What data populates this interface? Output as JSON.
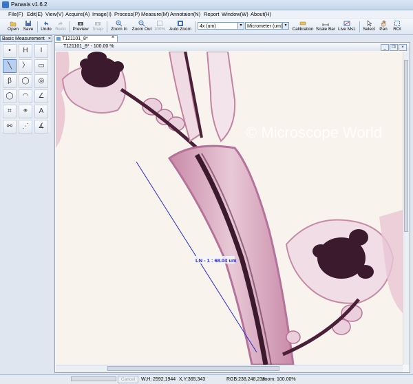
{
  "app": {
    "title": "Panasis v1.6.2"
  },
  "menu": [
    "File(F)",
    "Edit(E)",
    "View(V)",
    "Acquire(A)",
    "Image(I)",
    "Process(P)",
    "Measure(M)",
    "Annotaion(N)",
    "Report",
    "Window(W)",
    "About(H)"
  ],
  "toolbar": {
    "open": "Open",
    "save": "Save",
    "undo": "Undo",
    "redo": "Redo",
    "preview": "Preview",
    "snap": "Snap",
    "zoom_in": "Zoom In",
    "zoom_out": "Zoom Out",
    "zoom_100": "100%",
    "auto_zoom": "Auto Zoom",
    "objective_value": "4x (um)",
    "unit_value": "Micrometer (um)",
    "calibration": "Calibration",
    "scale_bar": "Scale Bar",
    "live_mst": "Live Mst.",
    "select": "Select",
    "pan": "Pan",
    "roi": "ROI"
  },
  "panel": {
    "title": "Basic Measurement",
    "close": "×"
  },
  "tools": [
    "•",
    "H",
    "I",
    "╲",
    "〉",
    "▭",
    "β",
    "◯",
    "◎",
    "◯",
    "◠",
    "∠",
    "⌗",
    "⚭",
    "A",
    "⚯",
    "⋰",
    "∡"
  ],
  "document": {
    "tab_label": "T121101_8*",
    "tab_close": "×",
    "window_title": "T121101_8* - 100.00 %",
    "watermark": "© Microscope World",
    "measurement_label": "LN - 1 : 68.04 um"
  },
  "status": {
    "cancel": "Cancel",
    "wh": "W,H: 2592,1944",
    "xy": "X,Y:365,343",
    "rgb": "RGB:238,248,238",
    "zoom": "zoom: 100.00%"
  },
  "colors": {
    "stain_pink": "#b8608c",
    "stain_dark": "#3a1a2c",
    "measure_line": "#2a2ad0",
    "background": "#f8f3ec"
  }
}
